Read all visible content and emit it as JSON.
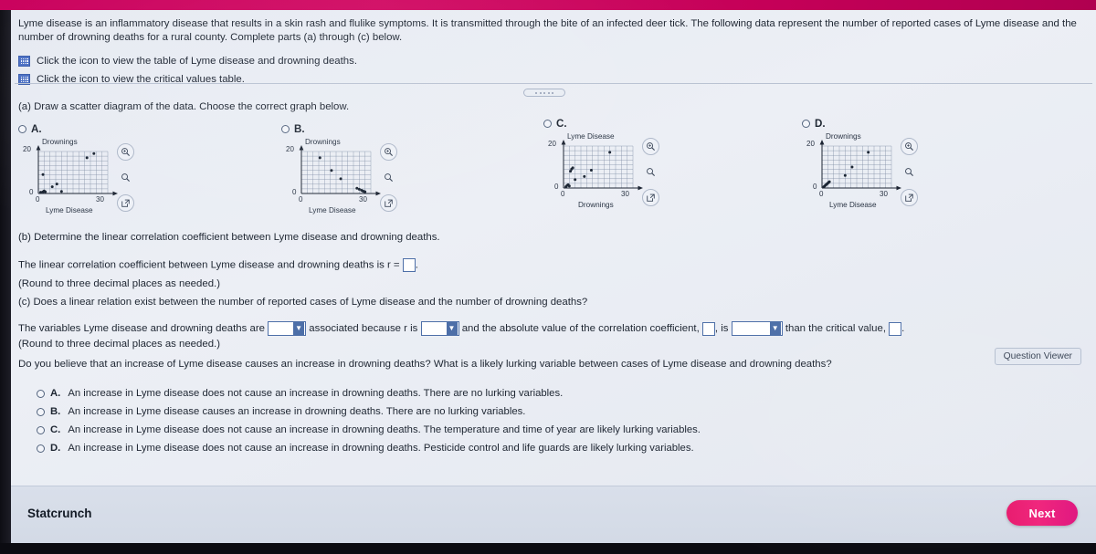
{
  "intro": {
    "paragraph": "Lyme disease is an inflammatory disease that results in a skin rash and flulike symptoms. It is transmitted through the bite of an infected deer tick. The following data represent the number of reported cases of Lyme disease and the number of drowning deaths for a rural county. Complete parts (a) through (c) below.",
    "link1": "Click the icon to view the table of Lyme disease and drowning deaths.",
    "link2": "Click the icon to view the critical values table.",
    "icon1_name": "table-icon",
    "icon2_name": "table-icon"
  },
  "parts": {
    "a_prompt": "(a) Draw a scatter diagram of the data. Choose the correct graph below.",
    "b_prompt": "(b) Determine the linear correlation coefficient between Lyme disease and drowning deaths.",
    "b_sentence": "The linear correlation coefficient between Lyme disease and drowning deaths is r =",
    "b_round": "(Round to three decimal places as needed.)",
    "c_prompt": "(c) Does a linear relation exist between the number of reported cases of Lyme disease and the number of drowning deaths?",
    "c_sentence_1": "The variables Lyme disease and drowning deaths are",
    "c_sentence_2": "associated because r is",
    "c_sentence_3": "and the absolute value of the correlation coefficient,",
    "c_sentence_4": ", is",
    "c_sentence_5": "than the critical value,",
    "c_sentence_6": ".",
    "c_round": "(Round to three decimal places as needed.)",
    "lurking_prompt": "Do you believe that an increase of Lyme disease causes an increase in drowning deaths? What is a likely lurking variable between cases of Lyme disease and drowning deaths?"
  },
  "choices": {
    "graph_options": [
      {
        "letter": "A.",
        "xlabel": "Lyme Disease",
        "ylabel": "Drownings",
        "xmax": "30",
        "ymax": "20",
        "xzero": "0",
        "yzero": "0"
      },
      {
        "letter": "B.",
        "xlabel": "Lyme Disease",
        "ylabel": "Drownings",
        "xmax": "30",
        "ymax": "20",
        "xzero": "0",
        "yzero": "0"
      },
      {
        "letter": "C.",
        "xlabel": "Drownings",
        "ylabel": "Lyme Disease",
        "xmax": "30",
        "ymax": "20",
        "xzero": "0",
        "yzero": "0"
      },
      {
        "letter": "D.",
        "xlabel": "Lyme Disease",
        "ylabel": "Drownings",
        "xmax": "30",
        "ymax": "20",
        "xzero": "0",
        "yzero": "0"
      }
    ],
    "lurking_options": [
      {
        "letter": "A.",
        "text": "An increase in Lyme disease does not cause an increase in drowning deaths. There are no lurking variables."
      },
      {
        "letter": "B.",
        "text": "An increase in Lyme disease causes an increase in drowning deaths. There are no lurking variables."
      },
      {
        "letter": "C.",
        "text": "An increase in Lyme disease does not cause an increase in drowning deaths. The temperature and time of year are likely lurking variables."
      },
      {
        "letter": "D.",
        "text": "An increase in Lyme disease does not cause an increase in drowning deaths. Pesticide control and life guards are likely lurking variables."
      }
    ]
  },
  "footer": {
    "statcrunch": "Statcrunch",
    "next": "Next",
    "question_viewer": "Question Viewer"
  },
  "colors": {
    "accent_pink": "#e8196d",
    "topbar": "#c9005c",
    "page_bg": "#e6eaf2",
    "input_border": "#4d6fa8",
    "icon_blue": "#4a6fc4"
  },
  "chart_data": [
    {
      "type": "scatter",
      "title": "A.",
      "xlabel": "Lyme Disease",
      "ylabel": "Drownings",
      "xlim": [
        0,
        30
      ],
      "ylim": [
        0,
        20
      ],
      "xticks": [
        0,
        30
      ],
      "yticks": [
        0,
        20
      ],
      "grid": true,
      "points": [
        [
          1,
          0.6
        ],
        [
          2,
          0.8
        ],
        [
          2.5,
          1.2
        ],
        [
          3,
          0.8
        ],
        [
          2,
          9
        ],
        [
          6,
          3.2
        ],
        [
          8,
          4.5
        ],
        [
          10,
          1
        ],
        [
          21,
          17
        ],
        [
          24,
          19
        ]
      ]
    },
    {
      "type": "scatter",
      "title": "B.",
      "xlabel": "Lyme Disease",
      "ylabel": "Drownings",
      "xlim": [
        0,
        30
      ],
      "ylim": [
        0,
        20
      ],
      "xticks": [
        0,
        30
      ],
      "yticks": [
        0,
        20
      ],
      "grid": true,
      "points": [
        [
          8,
          17
        ],
        [
          13,
          11
        ],
        [
          17,
          7
        ],
        [
          24,
          2.5
        ],
        [
          25,
          2
        ],
        [
          26,
          1.5
        ],
        [
          26.5,
          1.2
        ],
        [
          27,
          1
        ],
        [
          27.5,
          0.8
        ]
      ]
    },
    {
      "type": "scatter",
      "title": "C.",
      "xlabel": "Drownings",
      "ylabel": "Lyme Disease",
      "xlim": [
        0,
        30
      ],
      "ylim": [
        0,
        20
      ],
      "xticks": [
        0,
        30
      ],
      "yticks": [
        0,
        20
      ],
      "grid": true,
      "points": [
        [
          1,
          0.6
        ],
        [
          1.5,
          1.2
        ],
        [
          2,
          1.6
        ],
        [
          2.5,
          1
        ],
        [
          3,
          8
        ],
        [
          3.5,
          9
        ],
        [
          4,
          9.6
        ],
        [
          5,
          4
        ],
        [
          9,
          5.5
        ],
        [
          12,
          8.5
        ],
        [
          20,
          17
        ]
      ]
    },
    {
      "type": "scatter",
      "title": "D.",
      "xlabel": "Lyme Disease",
      "ylabel": "Drownings",
      "xlim": [
        0,
        30
      ],
      "ylim": [
        0,
        20
      ],
      "xticks": [
        0,
        30
      ],
      "yticks": [
        0,
        20
      ],
      "grid": true,
      "points": [
        [
          0.8,
          0.6
        ],
        [
          1.2,
          1.0
        ],
        [
          1.6,
          1.4
        ],
        [
          2.0,
          1.8
        ],
        [
          2.4,
          2.2
        ],
        [
          2.8,
          2.6
        ],
        [
          3.2,
          3.0
        ],
        [
          10,
          6
        ],
        [
          13,
          10
        ],
        [
          20,
          17
        ]
      ]
    }
  ]
}
